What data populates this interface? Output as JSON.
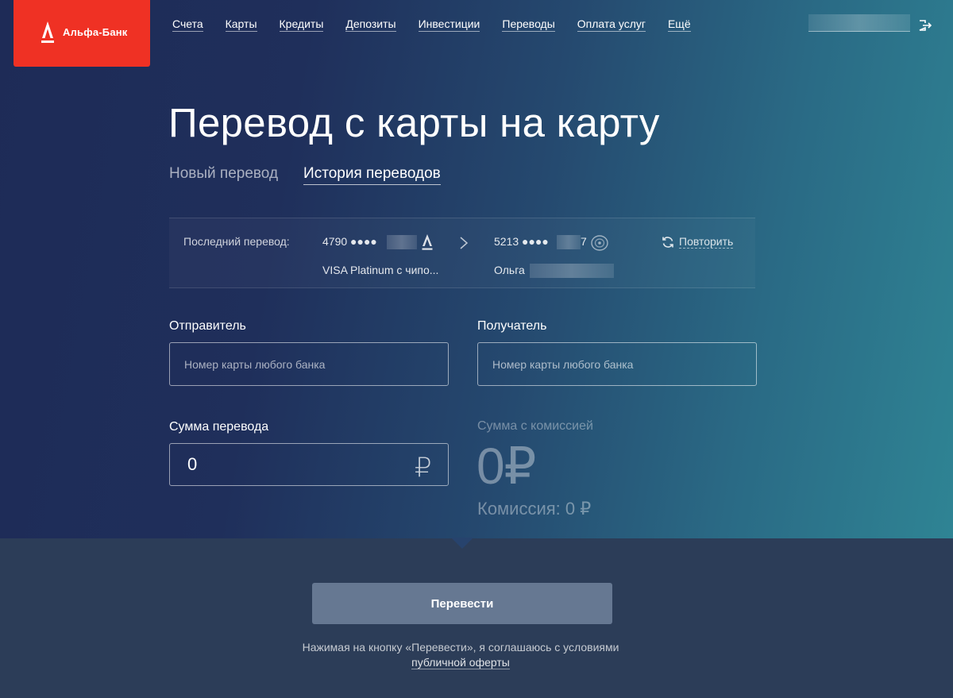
{
  "logo": {
    "text": "Альфа-Банк"
  },
  "nav": [
    {
      "label": "Счета"
    },
    {
      "label": "Карты"
    },
    {
      "label": "Кредиты"
    },
    {
      "label": "Депозиты"
    },
    {
      "label": "Инвестиции"
    },
    {
      "label": "Переводы"
    },
    {
      "label": "Оплата услуг"
    },
    {
      "label": "Ещё"
    }
  ],
  "page": {
    "title": "Перевод с карты на карту"
  },
  "tabs": {
    "new": "Новый перевод",
    "history": "История переводов"
  },
  "last_transfer": {
    "label": "Последний перевод:",
    "from_card": "4790 ●●●●",
    "from_card_desc": "VISA Platinum с чипо...",
    "to_card": "5213 ●●●●",
    "to_card_tail": "7",
    "to_name": "Ольга",
    "repeat": "Повторить"
  },
  "form": {
    "sender_label": "Отправитель",
    "sender_placeholder": "Номер карты любого банка",
    "recipient_label": "Получатель",
    "recipient_placeholder": "Номер карты любого банка",
    "amount_label": "Сумма перевода",
    "amount_value": "0",
    "currency_symbol": "₽",
    "commission_label": "Сумма с комиссией",
    "commission_total": "0₽",
    "commission_fee": "Комиссия: 0 ₽"
  },
  "submit": {
    "label": "Перевести",
    "agree_text": "Нажимая на кнопку «Перевести», я соглашаюсь с условиями",
    "agree_link": "публичной оферты"
  },
  "colors": {
    "brand_red": "#ef3124",
    "button_bg": "#667892",
    "bottom_bg": "#2c3d58"
  },
  "icons": [
    "alfa-logo-icon",
    "logout-icon",
    "alfa-bank-icon",
    "arrow-right-icon",
    "sberbank-icon",
    "repeat-icon",
    "ruble-icon"
  ]
}
